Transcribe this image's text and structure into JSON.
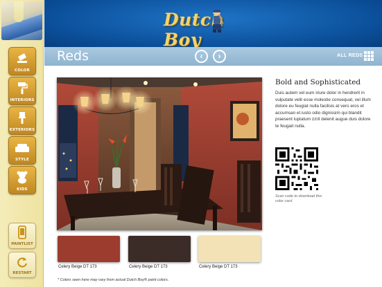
{
  "sidebar": {
    "nav": [
      {
        "label": "COLOR",
        "icon": "paint-bucket-icon"
      },
      {
        "label": "INTERIORS",
        "icon": "paint-roller-icon"
      },
      {
        "label": "EXTERIORS",
        "icon": "paint-brush-icon"
      },
      {
        "label": "STYLE",
        "icon": "sofa-icon"
      },
      {
        "label": "KIDS",
        "icon": "teddy-bear-icon"
      }
    ],
    "paintlist_label": "PAINTLIST",
    "restart_label": "RESTART",
    "active": "COLOR"
  },
  "header": {
    "logo_text": "Dutch Boy"
  },
  "titlebar": {
    "title": "Reds",
    "prev_icon": "chevron-left-icon",
    "next_icon": "chevron-right-icon",
    "all_label": "ALL REDS"
  },
  "content": {
    "heading": "Bold and Sophisticated",
    "body": "Duis autem vel eum iriure dolor in hendrerit in vulputate velit esse molestie consequat, vel illum dolore eu feugiat nulla facilisis at vero eros et accumsan et iusto odio dignissim qui blandit praesent luptatum zzril delenit augue duis dolore te feugait nulla.",
    "qr_caption": "Scan code to download this color card.",
    "swatches": [
      {
        "name": "Celery Beige DT 173",
        "color": "#9b3c2e"
      },
      {
        "name": "Celery Beige DT 173",
        "color": "#3b2c27"
      },
      {
        "name": "Celery Beige DT 173",
        "color": "#f3e2b6"
      }
    ],
    "disclaimer": "* Colors seen here may vary from actual Dutch Boy® paint colors."
  },
  "colors": {
    "header_blue": "#0b4f99",
    "titlebar_blue": "#9dbfd8",
    "sidebar_cream": "#f2e8ad",
    "nav_gold": "#d49c2e"
  }
}
